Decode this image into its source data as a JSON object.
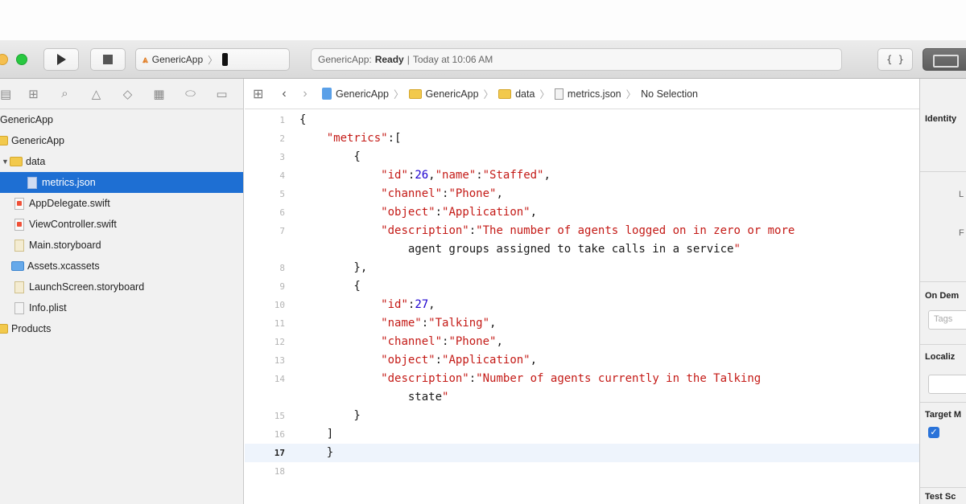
{
  "toolbar": {
    "scheme_name": "GenericApp",
    "scheme_sep": "〉",
    "activity": {
      "project": "GenericApp:",
      "status": "Ready",
      "divider": "|",
      "time": "Today at 10:06 AM"
    },
    "editor_mode_label": "{ }"
  },
  "navigator": {
    "tab_icons": [
      "folder-icon",
      "source-control-icon",
      "symbol-icon",
      "search-icon",
      "warning-icon",
      "test-icon",
      "debug-icon",
      "breakpoint-icon",
      "report-icon"
    ],
    "items": [
      {
        "label": "GenericApp",
        "type": "project",
        "level": 0
      },
      {
        "label": "GenericApp",
        "type": "folder",
        "level": 0
      },
      {
        "label": "data",
        "type": "folder",
        "level": 1,
        "expanded": true
      },
      {
        "label": "metrics.json",
        "type": "file",
        "level": 2,
        "selected": true
      },
      {
        "label": "AppDelegate.swift",
        "type": "swift",
        "level": 1
      },
      {
        "label": "ViewController.swift",
        "type": "swift",
        "level": 1
      },
      {
        "label": "Main.storyboard",
        "type": "story",
        "level": 1
      },
      {
        "label": "Assets.xcassets",
        "type": "assets",
        "level": 1
      },
      {
        "label": "LaunchScreen.storyboard",
        "type": "story",
        "level": 1
      },
      {
        "label": "Info.plist",
        "type": "plist",
        "level": 1
      },
      {
        "label": "Products",
        "type": "folder",
        "level": 0
      }
    ]
  },
  "jumpbar": {
    "crumbs": [
      "GenericApp",
      "GenericApp",
      "data",
      "metrics.json"
    ],
    "no_selection": "No Selection"
  },
  "code": {
    "current_line": 17,
    "lines": [
      {
        "n": "1",
        "text": "{"
      },
      {
        "n": "2",
        "text": "    \"metrics\":["
      },
      {
        "n": "3",
        "text": "        {"
      },
      {
        "n": "4",
        "text": "            \"id\":26,\"name\":\"Staffed\","
      },
      {
        "n": "5",
        "text": "            \"channel\":\"Phone\","
      },
      {
        "n": "6",
        "text": "            \"object\":\"Application\","
      },
      {
        "n": "7",
        "text": "            \"description\":\"The number of agents logged on in zero or more"
      },
      {
        "n": "",
        "text": "                agent groups assigned to take calls in a service\""
      },
      {
        "n": "8",
        "text": "        },"
      },
      {
        "n": "9",
        "text": "        {"
      },
      {
        "n": "10",
        "text": "            \"id\":27,"
      },
      {
        "n": "11",
        "text": "            \"name\":\"Talking\","
      },
      {
        "n": "12",
        "text": "            \"channel\":\"Phone\","
      },
      {
        "n": "13",
        "text": "            \"object\":\"Application\","
      },
      {
        "n": "14",
        "text": "            \"description\":\"Number of agents currently in the Talking"
      },
      {
        "n": "",
        "text": "                state\""
      },
      {
        "n": "15",
        "text": "        }"
      },
      {
        "n": "16",
        "text": "    ]"
      },
      {
        "n": "17",
        "text": "    }"
      },
      {
        "n": "18",
        "text": ""
      }
    ]
  },
  "inspector": {
    "identity": "Identity",
    "on_demand": "On Dem",
    "tags_placeholder": "Tags",
    "localization": "Localiz",
    "target": "Target M",
    "test": "Test Sc",
    "small_a": "L",
    "small_b": "F"
  }
}
